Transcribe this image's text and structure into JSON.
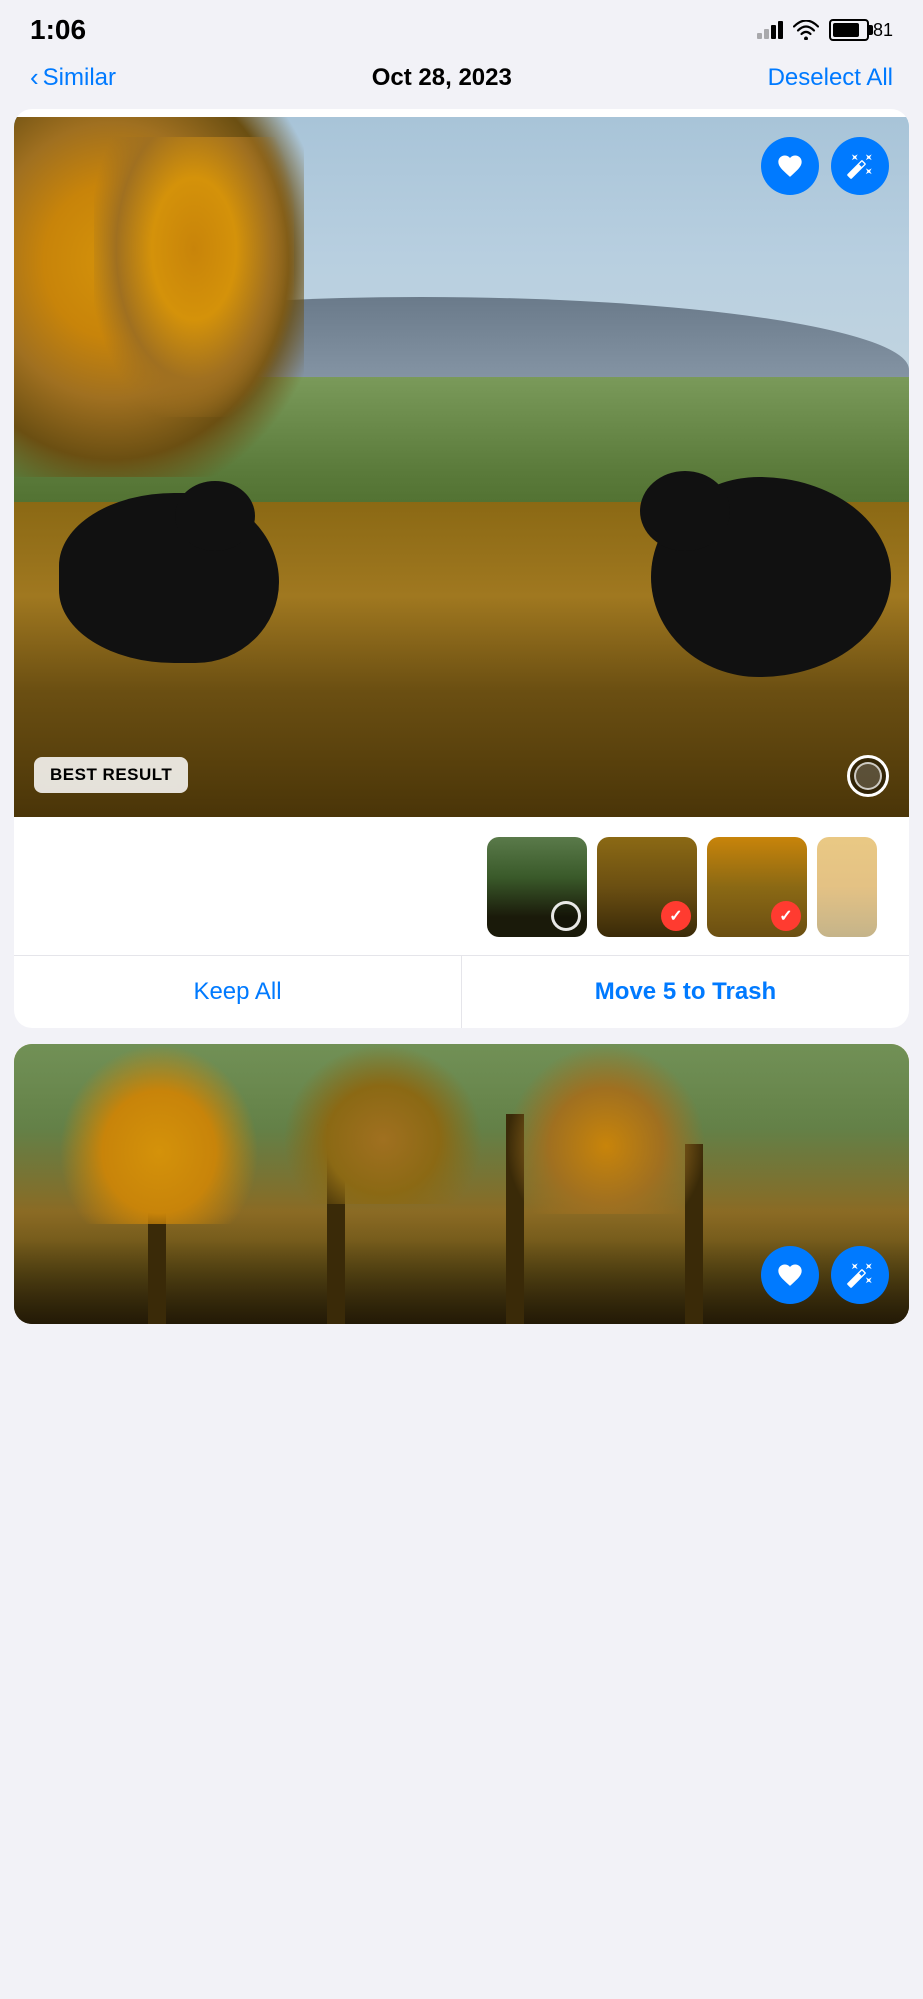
{
  "statusBar": {
    "time": "1:06",
    "batteryPercent": "81"
  },
  "navBar": {
    "backLabel": "Similar",
    "title": "Oct 28, 2023",
    "actionLabel": "Deselect All"
  },
  "mainCard": {
    "bestResultLabel": "BEST RESULT",
    "keepAllLabel": "Keep All",
    "moveToTrashLabel": "Move 5 to Trash"
  },
  "thumbnails": [
    {
      "id": 1,
      "selected": false
    },
    {
      "id": 2,
      "selected": true
    },
    {
      "id": 3,
      "selected": true
    },
    {
      "id": 4,
      "selected": false
    }
  ],
  "icons": {
    "heart": "heart-icon",
    "magic": "magic-wand-icon",
    "chevronLeft": "chevron-left-icon"
  },
  "colors": {
    "blue": "#007AFF",
    "red": "#FF3B30",
    "white": "#ffffff",
    "black": "#000000"
  }
}
